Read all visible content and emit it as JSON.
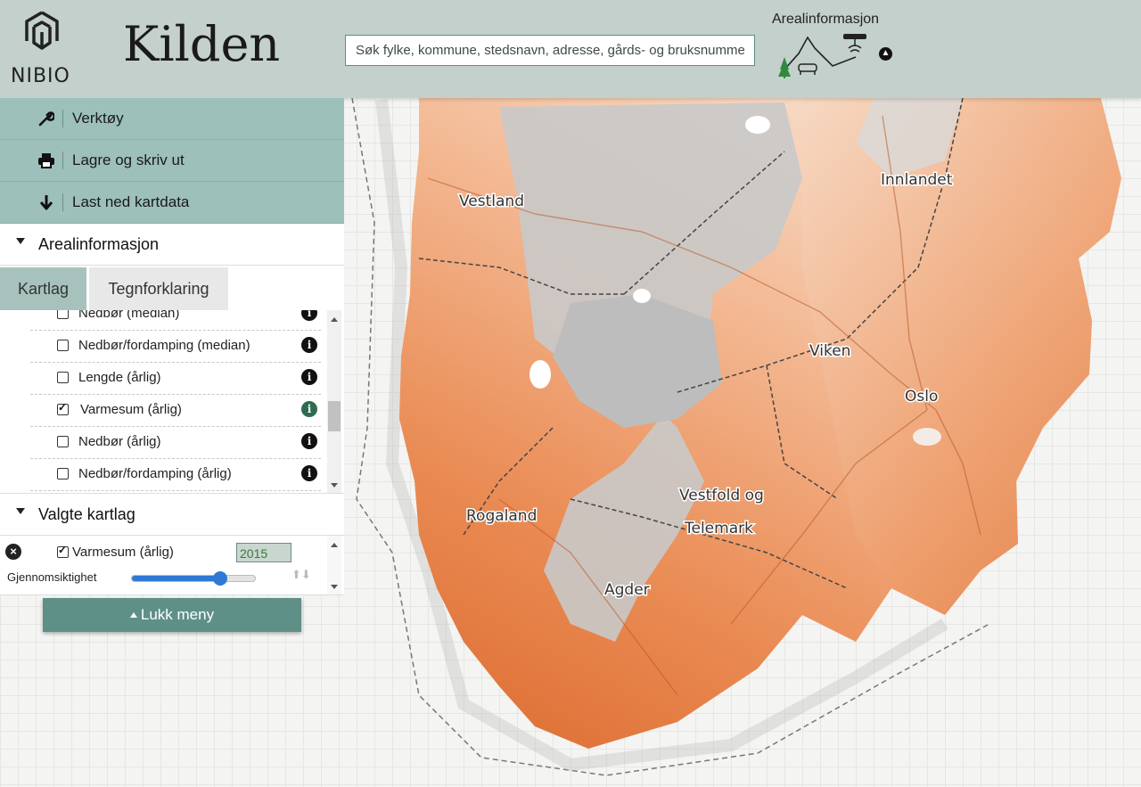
{
  "app": {
    "org": "NIBIO",
    "title": "Kilden"
  },
  "search": {
    "placeholder": "Søk fylke, kommune, stedsnavn, adresse, gårds- og bruksnummer"
  },
  "theme": {
    "title": "Arealinformasjon"
  },
  "tools": [
    {
      "label": "Verktøy",
      "icon": "wrench-icon"
    },
    {
      "label": "Lagre og skriv ut",
      "icon": "printer-icon"
    },
    {
      "label": "Last ned kartdata",
      "icon": "download-arrow-icon"
    }
  ],
  "sections": {
    "areal": "Arealinformasjon",
    "selected": "Valgte kartlag"
  },
  "tabs": {
    "layers": "Kartlag",
    "legend": "Tegnforklaring"
  },
  "layers": [
    {
      "label": "Nedbør (median)",
      "checked": false
    },
    {
      "label": "Nedbør/fordamping (median)",
      "checked": false
    },
    {
      "label": "Lengde (årlig)",
      "checked": false
    },
    {
      "label": "Varmesum (årlig)",
      "checked": true
    },
    {
      "label": "Nedbør (årlig)",
      "checked": false
    },
    {
      "label": "Nedbør/fordamping (årlig)",
      "checked": false
    }
  ],
  "selected_layer": {
    "name": "Varmesum (årlig)",
    "year": "2015",
    "opacity_label": "Gjennomsiktighet",
    "opacity": 0.72
  },
  "close_menu": "Lukk meny",
  "map": {
    "regions": [
      "Vestland",
      "Innlandet",
      "Viken",
      "Oslo",
      "Vestfold og",
      "Telemark",
      "Rogaland",
      "Agder"
    ],
    "colors": {
      "warm": "#e0753a",
      "mid": "#f0a878",
      "cool": "#f6d2b8",
      "mountain": "#c9c9c9"
    }
  }
}
